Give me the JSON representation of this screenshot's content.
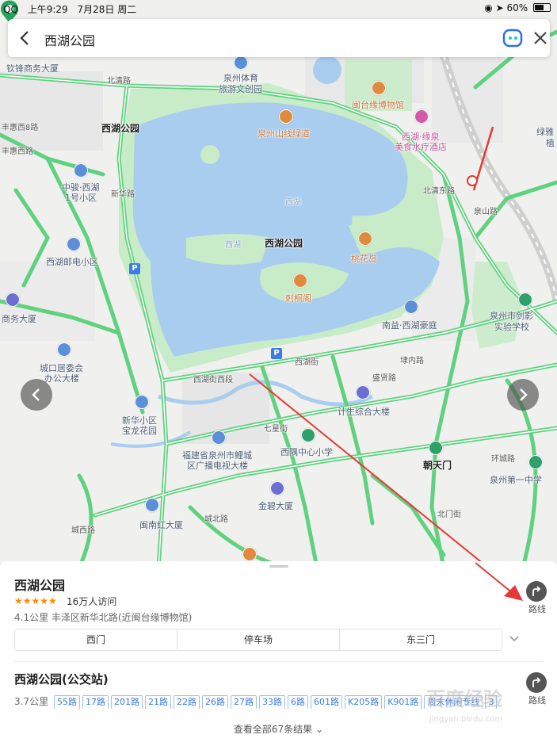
{
  "status_bar": {
    "carrier": "QQ",
    "time": "上午9:29",
    "date": "7月28日 周二",
    "battery": "60%"
  },
  "search": {
    "query": "西湖公园",
    "icons": {
      "back": "chevron-left-icon",
      "assistant": "assistant-face-icon",
      "close": "close-icon"
    }
  },
  "map": {
    "center_poi": "西湖公园",
    "labels": {
      "qiuzhou": "钦锋商务大厦",
      "beiqing": "北清路",
      "tiyu1": "泉州体育",
      "tiyu2": "旅游文创园",
      "mintai": "闽台缘博物馆",
      "xihu_bus": "西湖公园",
      "fenghui1": "丰惠西8路",
      "fenghui2": "丰惠西路",
      "shanxian": "泉州山线绿道",
      "yuanquan1": "西湖·缘泉",
      "yuanquan2": "美食水疗酒店",
      "lvya1": "绿雅",
      "lvya2": "植",
      "zhongjun1": "中骏·西湖",
      "zhongjun2": "1号小区",
      "xinhua_road": "新华路",
      "xihu_water": "西湖",
      "xihu_water2": "西湖",
      "park_name": "西湖公园",
      "beiqing_east": "北清东路",
      "quanshan": "泉山路",
      "taohua": "桃花岛",
      "youdian": "西湖邮电小区",
      "citong": "刺桐阁",
      "shangwu": "商务大厦",
      "nanyi": "南益·西湖豪庭",
      "jianying1": "泉州市剑影",
      "jianying2": "实验学校",
      "chengkou1": "城口居委会",
      "chengkou2": "办公大楼",
      "xihujie_xi": "西湖街西段",
      "xihujie": "西湖街",
      "gongnei": "埭内路",
      "shengxian": "盛贤路",
      "xinhua_garden1": "新华小区",
      "xinhua_garden2": "宝龙花园",
      "jisheng": "计生综合大楼",
      "qixing": "七星街",
      "xihu_school": "西隅中心小学",
      "chaotian": "朝天门",
      "fujian1": "福建省泉州市鲤城",
      "fujian2": "区广播电视大楼",
      "jinbi": "金碧大厦",
      "quanzhou1": "泉州第一中学",
      "minnan": "闽南红大厦",
      "chengxi": "城西路",
      "chengbei": "城北路",
      "beimen": "北门街",
      "huanmin": "环城路"
    }
  },
  "results": [
    {
      "title": "西湖公园",
      "rating_stars": "★★★★★",
      "visits": "16万人访问",
      "distance": "4.1公里",
      "address": "丰泽区新华北路(近闽台缘博物馆)",
      "route_label": "路线",
      "sub_pois": [
        "西门",
        "停车场",
        "东三门"
      ]
    },
    {
      "title": "西湖公园(公交站)",
      "distance": "3.7公里",
      "route_label": "路线",
      "bus_lines": [
        "55路",
        "17路",
        "201路",
        "21路",
        "22路",
        "26路",
        "27路",
        "33路",
        "6路",
        "601路",
        "K205路",
        "K901路",
        "周末休闲专线",
        "3"
      ]
    }
  ],
  "more_results": "查看全部67条结果",
  "watermark": {
    "name": "百度经验",
    "url": "jingyan.baidu.com"
  },
  "colors": {
    "road": "#5fd17f",
    "water": "#a9cdef",
    "park": "#c8ebc8",
    "annotation": "#e53935"
  }
}
